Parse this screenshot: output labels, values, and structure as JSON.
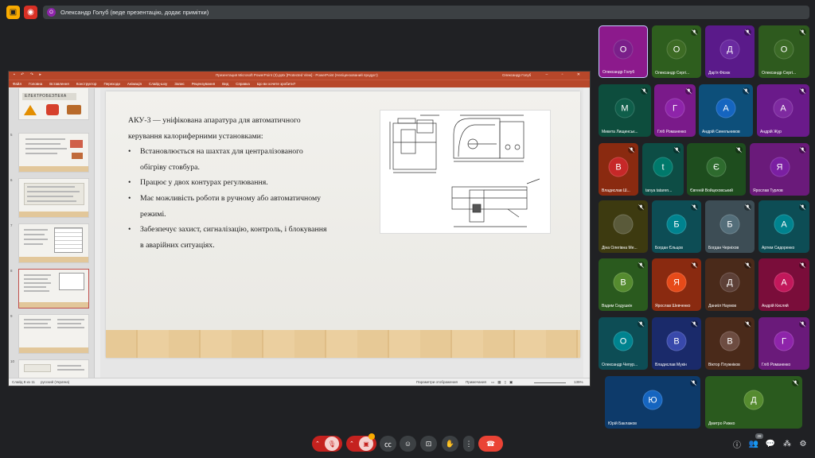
{
  "top": {
    "presenter_initial": "О",
    "presenter_text": "Олександр Голуб (веде презентацію, додає примітки)"
  },
  "ppt": {
    "title_center": "Презентация Microsoft PowerPoint (3).pptx [Protected View] - PowerPoint (Неліцензований продукт)",
    "title_user": "Олександр Голуб",
    "ribbon": [
      "Файл",
      "Головна",
      "Вставлення",
      "Конструктор",
      "Переходи",
      "Анімація",
      "Слайд-шоу",
      "Запис",
      "Рецензування",
      "Вид",
      "Справка",
      "Що ви хочете зробити?"
    ],
    "thumb_title": "ЕЛЕКТРОБЕЗПЕКА",
    "thumb_numbers": [
      "5",
      "6",
      "7",
      "8",
      "9",
      "10"
    ],
    "slide": {
      "intro": "АКУ-3 — уніфікована апаратура для автоматичного керування калориферними установками:",
      "bullets": [
        "Встановлюється на шахтах для централізованого обігріву стовбура.",
        "Працює у двох контурах регулювання.",
        "Має можливість роботи в ручному або автоматичному режимі.",
        "Забезпечує захист, сигналізацію, контроль, і блокування в аварійних ситуаціях."
      ]
    },
    "status": {
      "slide_info": "Слайд 8 из 11",
      "language": "русский (Україна)",
      "display_settings": "Параметри отображения",
      "notes": "Примечания",
      "zoom": "135%"
    }
  },
  "participants": [
    {
      "initial": "О",
      "name": "Олександр Голуб",
      "bg": "#8c1a8c",
      "av": "#7a1f8a"
    },
    {
      "initial": "О",
      "name": "Олександр Сергі...",
      "bg": "#2e5e1e",
      "av": "#3d6b24"
    },
    {
      "initial": "Д",
      "name": "Дар'я Фісюк",
      "bg": "#5a1a8a",
      "av": "#6a2aa0"
    },
    {
      "initial": "О",
      "name": "Олександр Сергі...",
      "bg": "#2e5a1e",
      "av": "#3b6a26"
    },
    {
      "initial": "М",
      "name": "Микита Лищинськ...",
      "bg": "#0d4d3d",
      "av": "#0f5e4a"
    },
    {
      "initial": "Г",
      "name": "Гліб Романенко",
      "bg": "#7a1a8a",
      "av": "#8e24aa"
    },
    {
      "initial": "А",
      "name": "Андрій Синельников",
      "bg": "#0d4f7a",
      "av": "#1565c0"
    },
    {
      "initial": "А",
      "name": "Андрій Жур",
      "bg": "#6a1a8a",
      "av": "#7e2aa0"
    },
    {
      "initial": "В",
      "name": "Владислав Ш...",
      "bg": "#8a2a10",
      "av": "#c62828"
    },
    {
      "initial": "t",
      "name": "tanya tataren...",
      "bg": "#0d4d45",
      "av": "#00796b"
    },
    {
      "initial": "Є",
      "name": "Євгеній Войцеховський",
      "bg": "#1e4d1e",
      "av": "#2e6b2e"
    },
    {
      "initial": "Я",
      "name": "Ярослав Турлов",
      "bg": "#6a1a7a",
      "av": "#7b1fa2"
    },
    {
      "initial": "",
      "name": "Діна Олегівна Ме...",
      "bg": "#3d3a10",
      "av": "#5a5a3a"
    },
    {
      "initial": "Б",
      "name": "Богдан Єльцов",
      "bg": "#0d4d55",
      "av": "#00838f"
    },
    {
      "initial": "Б",
      "name": "Богдан Черніхов",
      "bg": "#3d4d55",
      "av": "#546e7a"
    },
    {
      "initial": "А",
      "name": "Артем Сидоренко",
      "bg": "#0d4d55",
      "av": "#00838f"
    },
    {
      "initial": "В",
      "name": "Вадим Седушкін",
      "bg": "#2a5a1e",
      "av": "#558b2f"
    },
    {
      "initial": "Я",
      "name": "Ярослав Шевченко",
      "bg": "#8a2a10",
      "av": "#e64a19"
    },
    {
      "initial": "Д",
      "name": "Даниїл Наумов",
      "bg": "#4a2a1a",
      "av": "#5d4037"
    },
    {
      "initial": "А",
      "name": "Андрій Кисляй",
      "bg": "#7a0d3a",
      "av": "#c2185b"
    },
    {
      "initial": "О",
      "name": "Олександр Чепур...",
      "bg": "#0d4d55",
      "av": "#00838f"
    },
    {
      "initial": "В",
      "name": "Владислав Мукін",
      "bg": "#1a2a6a",
      "av": "#3949ab"
    },
    {
      "initial": "В",
      "name": "Віктор Плужніков",
      "bg": "#4a2a1a",
      "av": "#6d4c41"
    },
    {
      "initial": "Г",
      "name": "Гліб Романенко",
      "bg": "#6a1a7a",
      "av": "#8e24aa"
    },
    {
      "initial": "Ю",
      "name": "Юрій Баклажов",
      "bg": "#0d3a6a",
      "av": "#1565c0"
    },
    {
      "initial": "Д",
      "name": "Дмитро Рижко",
      "bg": "#2a5a1e",
      "av": "#558b2f"
    }
  ],
  "bottom": {
    "reactions_badge": "",
    "participant_count": "28"
  }
}
